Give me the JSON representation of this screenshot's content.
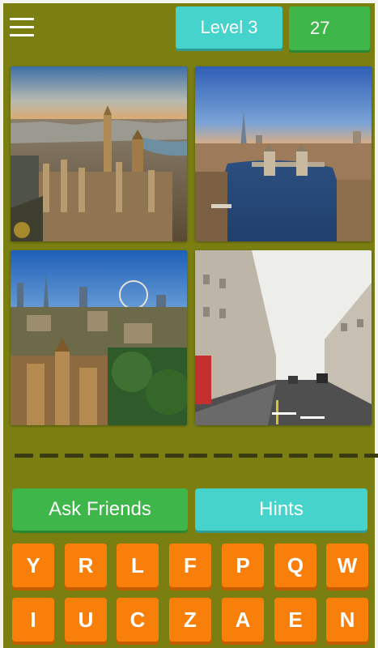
{
  "header": {
    "menu_icon": "hamburger-menu-icon",
    "level_label": "Level 3",
    "coins": "27"
  },
  "puzzle": {
    "photos": [
      {
        "subject": "Westminster aerial view at sunset"
      },
      {
        "subject": "Tower Bridge and the Shard aerial view"
      },
      {
        "subject": "London skyline with the London Eye"
      },
      {
        "subject": "Regent Street"
      }
    ],
    "answer_slots": [
      7,
      8
    ]
  },
  "actions": {
    "ask_friends_label": "Ask Friends",
    "hints_label": "Hints"
  },
  "keyboard": {
    "rows": [
      [
        "Y",
        "R",
        "L",
        "F",
        "P",
        "Q",
        "W"
      ],
      [
        "I",
        "U",
        "C",
        "Z",
        "A",
        "E",
        "N"
      ]
    ]
  },
  "colors": {
    "background": "#7b7f12",
    "level_badge": "#45d3cb",
    "coins_badge": "#3fb64a",
    "key": "#f77f0a",
    "slot": "#3a3b12"
  }
}
